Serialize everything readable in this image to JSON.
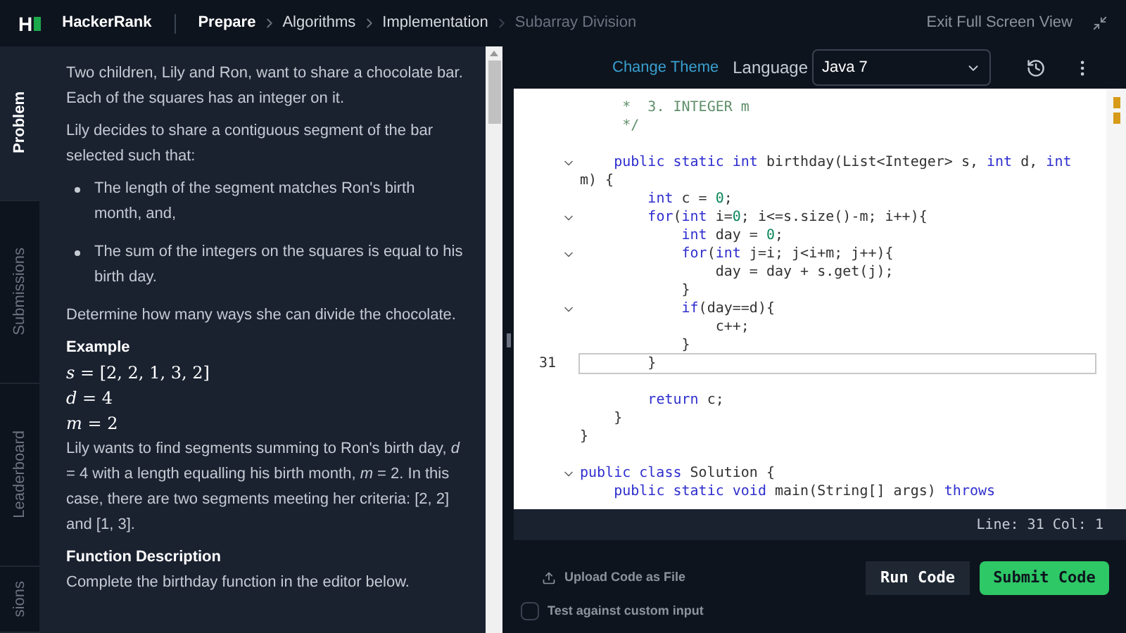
{
  "header": {
    "logo": "H",
    "brand": "HackerRank",
    "breadcrumbs": [
      {
        "label": "Prepare",
        "kind": "root"
      },
      {
        "label": "Algorithms",
        "kind": "link"
      },
      {
        "label": "Implementation",
        "kind": "link"
      },
      {
        "label": "Subarray Division",
        "kind": "current"
      }
    ],
    "exit_fullscreen": "Exit Full Screen View"
  },
  "side_tabs": [
    {
      "label": "Problem",
      "selected": true
    },
    {
      "label": "Submissions",
      "selected": false
    },
    {
      "label": "Leaderboard",
      "selected": false
    },
    {
      "label": "sions",
      "selected": false
    }
  ],
  "problem": {
    "blocks": [
      {
        "kind": "para",
        "text": "Two children, Lily and Ron, want to share a chocolate bar. Each of the squares has an integer on it."
      },
      {
        "kind": "para",
        "text": "Lily decides to share a contiguous segment of the bar selected such that:"
      },
      {
        "kind": "bullets",
        "items": [
          "The length of the segment matches Ron's birth month, and,",
          "The sum of the integers on the squares is equal to his birth day."
        ]
      },
      {
        "kind": "para",
        "text": "Determine how many ways she can divide the chocolate."
      },
      {
        "kind": "heading",
        "text": "Example"
      },
      {
        "kind": "math",
        "text": "*s* = [2, 2, 1, 3, 2]"
      },
      {
        "kind": "math",
        "text": "*d* = 4"
      },
      {
        "kind": "math",
        "text": "*m* = 2"
      },
      {
        "kind": "para",
        "text": "Lily wants to find segments summing to Ron's birth day, *d* = 4 with a length equalling his birth month, *m* = 2. In this case, there are two segments meeting her criteria: [2, 2] and [1, 3]."
      },
      {
        "kind": "heading",
        "text": "Function Description"
      },
      {
        "kind": "para",
        "text": "Complete the birthday function in the editor below."
      }
    ]
  },
  "editor": {
    "change_theme": "Change Theme",
    "language_label": "Language",
    "language": "Java 7",
    "lines": [
      {
        "foldable": false,
        "current": false,
        "tokens": [
          {
            "text": "     *  3. INTEGER m",
            "kind": "comment"
          }
        ]
      },
      {
        "foldable": false,
        "current": false,
        "tokens": [
          {
            "text": "     */",
            "kind": "comment"
          }
        ]
      },
      {
        "foldable": false,
        "current": false
      },
      {
        "foldable": true,
        "current": false,
        "tokens": [
          {
            "text": "    public static int",
            "kind": "keyword"
          },
          {
            "text": " birthday(List<Integer> s, ",
            "kind": "plain"
          },
          {
            "text": "int",
            "kind": "keyword"
          },
          {
            "text": " d, ",
            "kind": "plain"
          },
          {
            "text": "int",
            "kind": "keyword"
          },
          {
            "text": " m) {",
            "kind": "plain"
          }
        ]
      },
      {
        "foldable": false,
        "current": false,
        "tokens": [
          {
            "text": "        int",
            "kind": "keyword"
          },
          {
            "text": " c = ",
            "kind": "plain"
          },
          {
            "text": "0",
            "kind": "number"
          },
          {
            "text": ";",
            "kind": "plain"
          }
        ]
      },
      {
        "foldable": true,
        "current": false,
        "tokens": [
          {
            "text": "        for",
            "kind": "keyword"
          },
          {
            "text": "(",
            "kind": "plain"
          },
          {
            "text": "int",
            "kind": "keyword"
          },
          {
            "text": " i=",
            "kind": "plain"
          },
          {
            "text": "0",
            "kind": "number"
          },
          {
            "text": "; i<=s.size()-m; i++){",
            "kind": "plain"
          }
        ]
      },
      {
        "foldable": false,
        "current": false,
        "tokens": [
          {
            "text": "            int",
            "kind": "keyword"
          },
          {
            "text": " day = ",
            "kind": "plain"
          },
          {
            "text": "0",
            "kind": "number"
          },
          {
            "text": ";",
            "kind": "plain"
          }
        ]
      },
      {
        "foldable": true,
        "current": false,
        "tokens": [
          {
            "text": "            for",
            "kind": "keyword"
          },
          {
            "text": "(",
            "kind": "plain"
          },
          {
            "text": "int",
            "kind": "keyword"
          },
          {
            "text": " j=i; j<i+m; j++){",
            "kind": "plain"
          }
        ]
      },
      {
        "foldable": false,
        "current": false,
        "tokens": [
          {
            "text": "                day = day + s.get(j);",
            "kind": "plain"
          }
        ]
      },
      {
        "foldable": false,
        "current": false,
        "tokens": [
          {
            "text": "            }",
            "kind": "plain"
          }
        ]
      },
      {
        "foldable": true,
        "current": false,
        "tokens": [
          {
            "text": "            if",
            "kind": "keyword"
          },
          {
            "text": "(day==d){",
            "kind": "plain"
          }
        ]
      },
      {
        "foldable": false,
        "current": false,
        "tokens": [
          {
            "text": "                c++;",
            "kind": "plain"
          }
        ]
      },
      {
        "foldable": false,
        "current": false,
        "tokens": [
          {
            "text": "            }",
            "kind": "plain"
          }
        ]
      },
      {
        "number": "31",
        "foldable": false,
        "current": true,
        "tokens": [
          {
            "text": "        }",
            "kind": "plain"
          }
        ]
      },
      {
        "foldable": false,
        "current": false
      },
      {
        "foldable": false,
        "current": false,
        "tokens": [
          {
            "text": "        return",
            "kind": "keyword"
          },
          {
            "text": " c;",
            "kind": "plain"
          }
        ]
      },
      {
        "foldable": false,
        "current": false,
        "tokens": [
          {
            "text": "    }",
            "kind": "plain"
          }
        ]
      },
      {
        "foldable": false,
        "current": false,
        "tokens": [
          {
            "text": "}",
            "kind": "plain"
          }
        ]
      },
      {
        "foldable": false,
        "current": false
      },
      {
        "foldable": true,
        "current": false,
        "tokens": [
          {
            "text": "public class",
            "kind": "keyword"
          },
          {
            "text": " Solution {",
            "kind": "plain"
          }
        ]
      },
      {
        "foldable": false,
        "current": false,
        "tokens": [
          {
            "text": "    public static void",
            "kind": "keyword"
          },
          {
            "text": " main(String[] args) ",
            "kind": "plain"
          },
          {
            "text": "throws",
            "kind": "keyword"
          }
        ]
      }
    ],
    "status": "Line: 31 Col: 1"
  },
  "footer": {
    "upload": "Upload Code as File",
    "run": "Run Code",
    "submit": "Submit Code",
    "custom_input": {
      "label": "Test against custom input",
      "checked": false
    }
  }
}
